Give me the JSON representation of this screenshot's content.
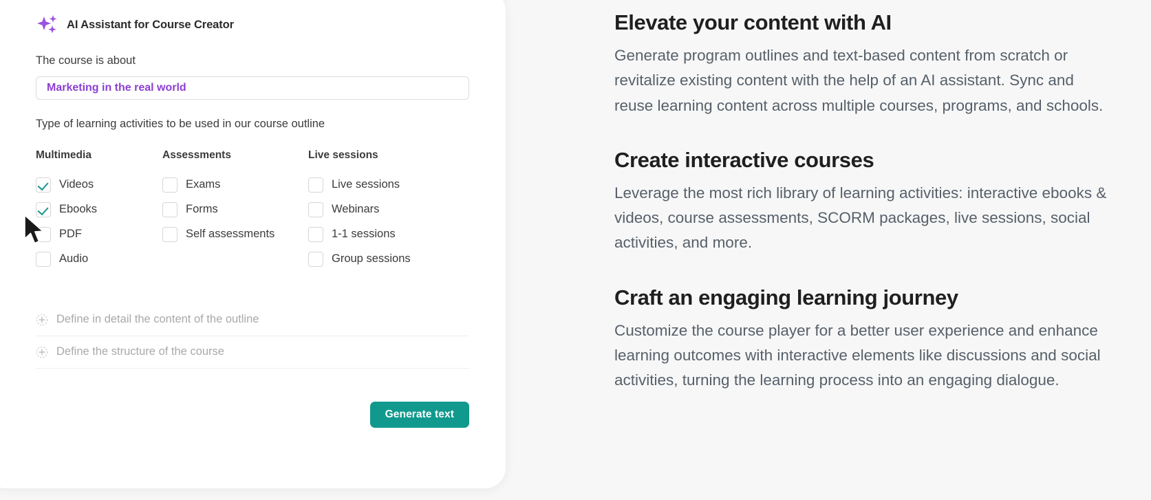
{
  "app": {
    "title": "AI Assistant for Course Creator",
    "icon": "sparkles-icon"
  },
  "form": {
    "course_label": "The course is about",
    "course_value": "Marketing in the real world",
    "course_placeholder": "The course is about",
    "activities_label": "Type of learning activities to be used in our course outline",
    "columns": [
      {
        "title": "Multimedia",
        "options": [
          {
            "label": "Videos",
            "checked": true
          },
          {
            "label": "Ebooks",
            "checked": true
          },
          {
            "label": "PDF",
            "checked": false
          },
          {
            "label": "Audio",
            "checked": false
          }
        ]
      },
      {
        "title": "Assessments",
        "options": [
          {
            "label": "Exams",
            "checked": false
          },
          {
            "label": "Forms",
            "checked": false
          },
          {
            "label": "Self assessments",
            "checked": false
          }
        ]
      },
      {
        "title": "Live sessions",
        "options": [
          {
            "label": "Live sessions",
            "checked": false
          },
          {
            "label": "Webinars",
            "checked": false
          },
          {
            "label": "1-1 sessions",
            "checked": false
          },
          {
            "label": "Group sessions",
            "checked": false
          }
        ]
      }
    ],
    "expandables": [
      {
        "label": "Define in detail the content of the outline",
        "icon": "plus-circle-icon"
      },
      {
        "label": "Define the structure of the course",
        "icon": "plus-circle-icon"
      }
    ],
    "submit_label": "Generate text"
  },
  "features": [
    {
      "title": "Elevate your content with AI",
      "body": "Generate program outlines and text-based content from scratch or revitalize existing content with the help of an AI assistant. Sync and reuse learning content across multiple courses, programs, and schools."
    },
    {
      "title": "Create interactive courses",
      "body": "Leverage the most rich library of learning activities: interactive ebooks & videos, course assessments, SCORM packages, live sessions, social activities, and more."
    },
    {
      "title": "Craft an engaging learning journey",
      "body": "Customize the course player for a better user experience and enhance learning outcomes with interactive elements like discussions and social activities, turning the learning process into an engaging dialogue."
    }
  ],
  "colors": {
    "accent_purple": "#8b3fd1",
    "accent_teal": "#11998e",
    "check_teal": "#17958a",
    "page_background": "#f7f7f7",
    "card_background": "#ffffff"
  }
}
